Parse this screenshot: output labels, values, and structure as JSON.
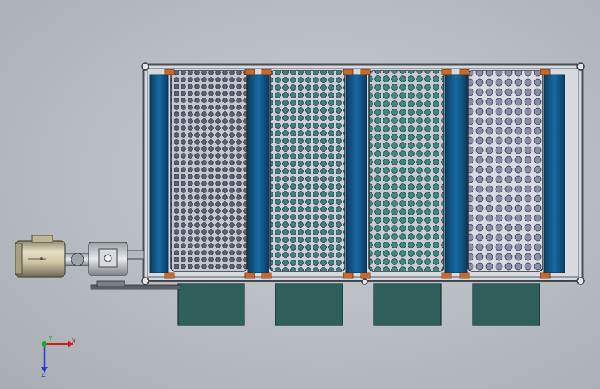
{
  "viewport": {
    "background_top": "#c9ced3",
    "background_bottom": "#a9aeb4"
  },
  "machine": {
    "frame_color": "#4a4e55",
    "frame_fill": "#d7dade",
    "belt_blue": "#0f5a8c",
    "belt_dark": "#0a3e63",
    "bearing_orange": "#c8682a",
    "hopper_color": "#2f5f5b",
    "drums": [
      {
        "name": "drum-1",
        "hole_color": "#5d6070",
        "plate": "#c5c7d0",
        "hole_size": "small"
      },
      {
        "name": "drum-2",
        "hole_color": "#3f7f80",
        "plate": "#cdd0d8",
        "hole_size": "medium"
      },
      {
        "name": "drum-3",
        "hole_color": "#3a8a7e",
        "plate": "#c8cbd3",
        "hole_size": "medium"
      },
      {
        "name": "drum-4",
        "hole_color": "#8a8da6",
        "plate": "#d9dbe3",
        "hole_size": "large"
      }
    ],
    "hopper_count": 4,
    "motor": {
      "body": "#cfc6a5",
      "shade": "#7e7862"
    }
  },
  "triad": {
    "x_label": "X",
    "y_label": "Y",
    "z_label": "Z",
    "x_color": "#d01c1c",
    "y_color": "#1fa82a",
    "z_color": "#2140c9"
  }
}
